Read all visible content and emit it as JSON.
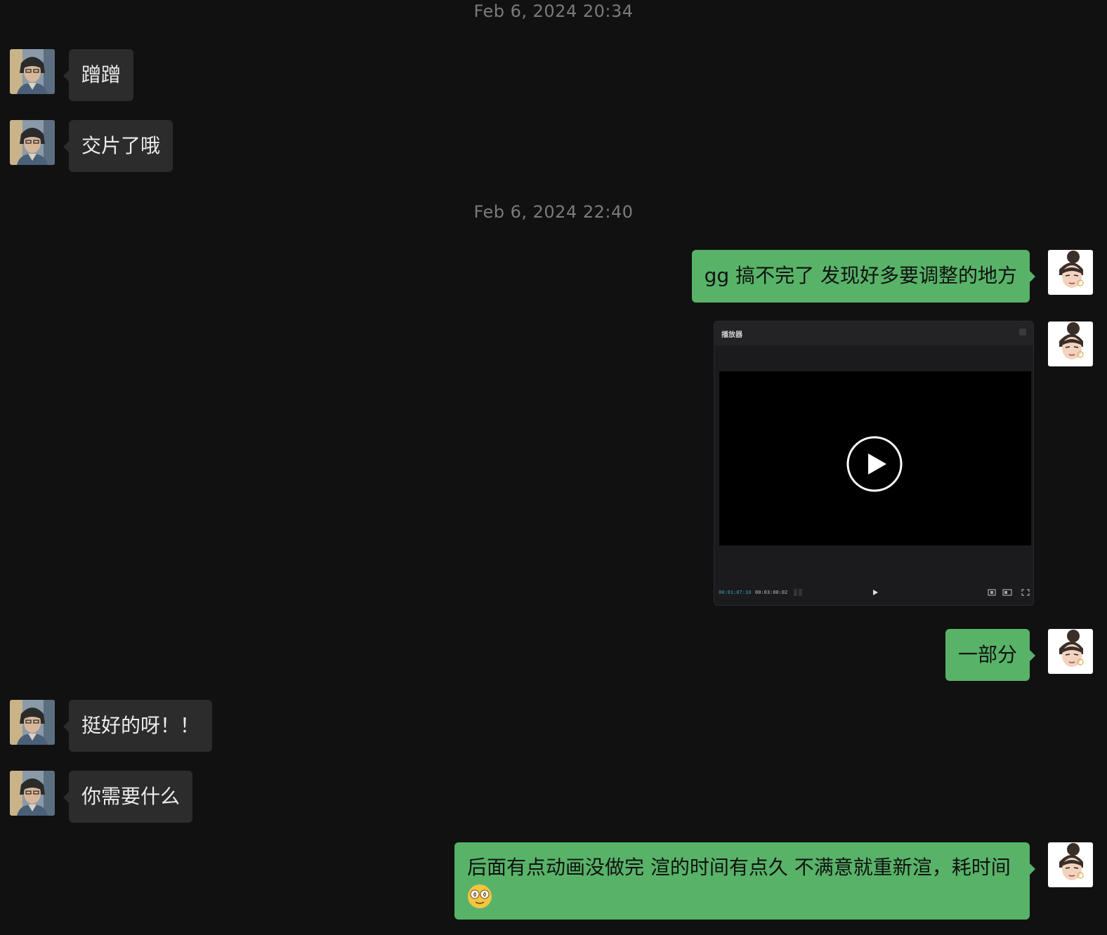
{
  "timestamps": [
    "Feb 6, 2024 20:34",
    "Feb 6, 2024 22:40"
  ],
  "messages": [
    {
      "side": "in",
      "text": "蹭蹭"
    },
    {
      "side": "in",
      "text": "交片了哦"
    },
    {
      "side": "out",
      "text": "gg 搞不完了 发现好多要调整的地方"
    },
    {
      "side": "out",
      "type": "video"
    },
    {
      "side": "out",
      "text": "一部分"
    },
    {
      "side": "in",
      "text": "挺好的呀！！"
    },
    {
      "side": "in",
      "text": "你需要什么"
    },
    {
      "side": "out",
      "text": "后面有点动画没做完 渲的时间有点久 不满意就重新渲，耗时间",
      "emoji": "dizzy-face-emoji"
    }
  ],
  "video": {
    "window_title": "播放器",
    "time_current": "00:01:07:10",
    "time_total": "00:03:00:02",
    "play_icon": "play-icon",
    "accent_color": "#3aa0b8"
  },
  "colors": {
    "background": "#111111",
    "incoming_bubble": "#2c2c2c",
    "outgoing_bubble": "#58b368",
    "timestamp": "#7b7b7b"
  }
}
